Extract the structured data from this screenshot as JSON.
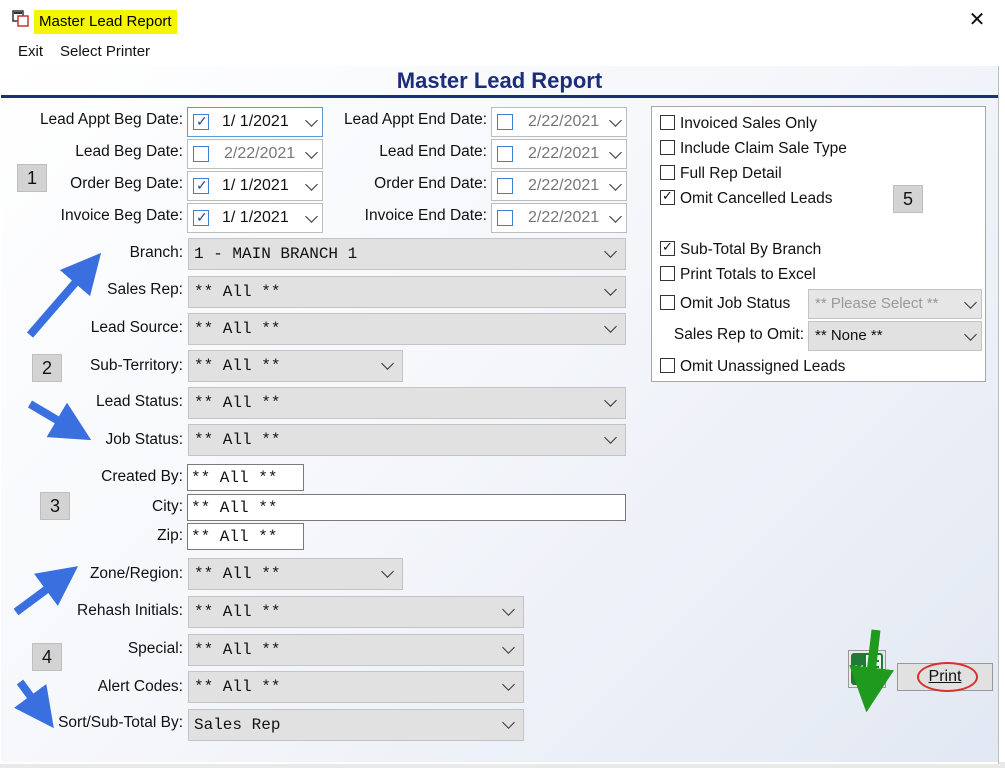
{
  "window": {
    "title": "Master Lead Report",
    "close_glyph": "✕"
  },
  "menu": {
    "exit": "Exit",
    "select_printer": "Select Printer"
  },
  "header": {
    "title": "Master Lead Report"
  },
  "dates": {
    "lead_appt_beg": {
      "label": "Lead Appt Beg Date:",
      "checked": true,
      "value": "1/  1/2021"
    },
    "lead_appt_end": {
      "label": "Lead Appt End Date:",
      "checked": false,
      "value": "2/22/2021"
    },
    "lead_beg": {
      "label": "Lead Beg Date:",
      "checked": false,
      "value": "2/22/2021"
    },
    "lead_end": {
      "label": "Lead End Date:",
      "checked": false,
      "value": "2/22/2021"
    },
    "order_beg": {
      "label": "Order Beg Date:",
      "checked": true,
      "value": "1/  1/2021"
    },
    "order_end": {
      "label": "Order End Date:",
      "checked": false,
      "value": "2/22/2021"
    },
    "invoice_beg": {
      "label": "Invoice Beg Date:",
      "checked": true,
      "value": "1/  1/2021"
    },
    "invoice_end": {
      "label": "Invoice End Date:",
      "checked": false,
      "value": "2/22/2021"
    }
  },
  "filters": {
    "branch": {
      "label": "Branch:",
      "value": "1  - MAIN BRANCH 1"
    },
    "sales_rep": {
      "label": "Sales Rep:",
      "value": "** All **"
    },
    "lead_source": {
      "label": "Lead Source:",
      "value": "** All **"
    },
    "sub_territory": {
      "label": "Sub-Territory:",
      "value": "** All **"
    },
    "lead_status": {
      "label": "Lead Status:",
      "value": "** All **"
    },
    "job_status": {
      "label": "Job Status:",
      "value": "** All **"
    },
    "created_by": {
      "label": "Created By:",
      "value": "** All **"
    },
    "city": {
      "label": "City:",
      "value": "** All **"
    },
    "zip": {
      "label": "Zip:",
      "value": "** All **"
    },
    "zone_region": {
      "label": "Zone/Region:",
      "value": "** All **"
    },
    "rehash_initials": {
      "label": "Rehash Initials:",
      "value": "** All **"
    },
    "special": {
      "label": "Special:",
      "value": "** All **"
    },
    "alert_codes": {
      "label": "Alert Codes:",
      "value": "** All **"
    },
    "sort_subtotal": {
      "label": "Sort/Sub-Total By:",
      "value": "Sales Rep"
    }
  },
  "options": {
    "invoiced_sales_only": {
      "label": "Invoiced Sales Only",
      "checked": false
    },
    "include_claim_sale_type": {
      "label": "Include Claim Sale Type",
      "checked": false
    },
    "full_rep_detail": {
      "label": "Full Rep Detail",
      "checked": false
    },
    "omit_cancelled_leads": {
      "label": "Omit Cancelled Leads",
      "checked": true
    },
    "sub_total_by_branch": {
      "label": "Sub-Total By Branch",
      "checked": true
    },
    "print_totals_to_excel": {
      "label": "Print Totals to Excel",
      "checked": false
    },
    "omit_job_status": {
      "label": "Omit Job Status",
      "checked": false,
      "select_value": "** Please Select **"
    },
    "sales_rep_to_omit": {
      "label": "Sales Rep to Omit:",
      "value": "** None **"
    },
    "omit_unassigned_leads": {
      "label": "Omit Unassigned Leads",
      "checked": false
    }
  },
  "section_tags": [
    "1",
    "2",
    "3",
    "4",
    "5"
  ],
  "buttons": {
    "print": "Print",
    "excel_icon": "excel-icon"
  },
  "colors": {
    "title_highlight": "#f5f500",
    "header_blue": "#1c2e7a",
    "arrow_blue": "#3a6fe0",
    "arrow_green": "#1f9a1f",
    "print_ring": "#d9302c"
  }
}
